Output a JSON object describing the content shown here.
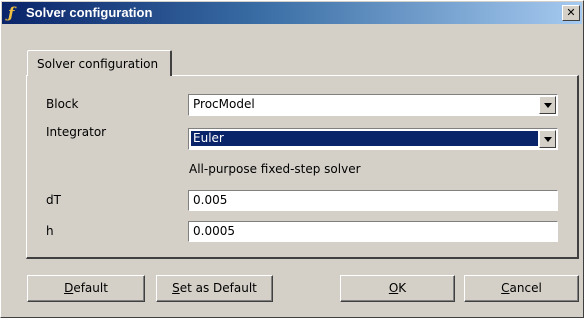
{
  "window": {
    "title": "Solver configuration",
    "close_glyph": "✕"
  },
  "tabs": [
    {
      "label": "Solver configuration",
      "active": true
    }
  ],
  "form": {
    "block": {
      "label": "Block",
      "value": "ProcModel"
    },
    "integrator": {
      "label": "Integrator",
      "value": "Euler",
      "description": "All-purpose fixed-step solver"
    },
    "dT": {
      "label": "dT",
      "value": "0.005"
    },
    "h": {
      "label": "h",
      "value": "0.0005"
    }
  },
  "buttons": {
    "default": {
      "accel": "D",
      "rest": "efault"
    },
    "set_as_default": {
      "accel": "S",
      "rest": "et as Default"
    },
    "ok": {
      "accel": "O",
      "rest": "K"
    },
    "cancel": {
      "accel": "C",
      "rest": "ancel"
    }
  },
  "icons": {
    "title": "function-icon",
    "close": "close-icon",
    "dropdown": "chevron-down-icon"
  },
  "colors": {
    "title_start": "#0a246a",
    "title_end": "#a6caf0",
    "face": "#d4d0c8",
    "selection": "#0a246a"
  }
}
